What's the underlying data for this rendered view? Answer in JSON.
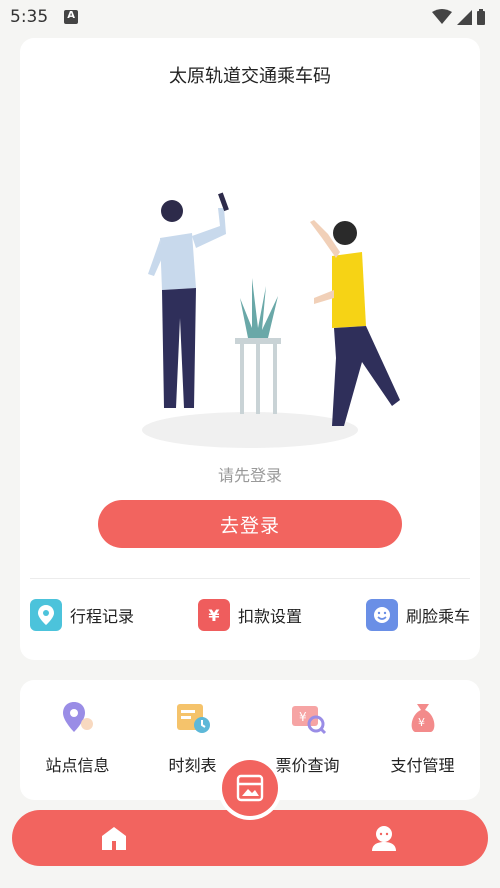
{
  "status_bar": {
    "time": "5:35"
  },
  "main_card": {
    "title": "太原轨道交通乘车码",
    "login_hint": "请先登录",
    "login_button": "去登录",
    "actions": [
      {
        "label": "行程记录",
        "icon": "location-pin-icon",
        "color": "#4cc3db"
      },
      {
        "label": "扣款设置",
        "icon": "yuan-icon",
        "color": "#ef5d5d",
        "glyph": "¥"
      },
      {
        "label": "刷脸乘车",
        "icon": "smile-face-icon",
        "color": "#6a8fe6"
      }
    ]
  },
  "services": [
    {
      "label": "站点信息",
      "icon": "station-pin-icon"
    },
    {
      "label": "时刻表",
      "icon": "timetable-icon"
    },
    {
      "label": "票价查询",
      "icon": "fare-search-icon"
    },
    {
      "label": "支付管理",
      "icon": "money-bag-icon"
    }
  ],
  "tab_bar": {
    "accent": "#f2645f",
    "tabs": [
      "home-icon",
      "qrcode-center-icon",
      "profile-icon"
    ]
  }
}
